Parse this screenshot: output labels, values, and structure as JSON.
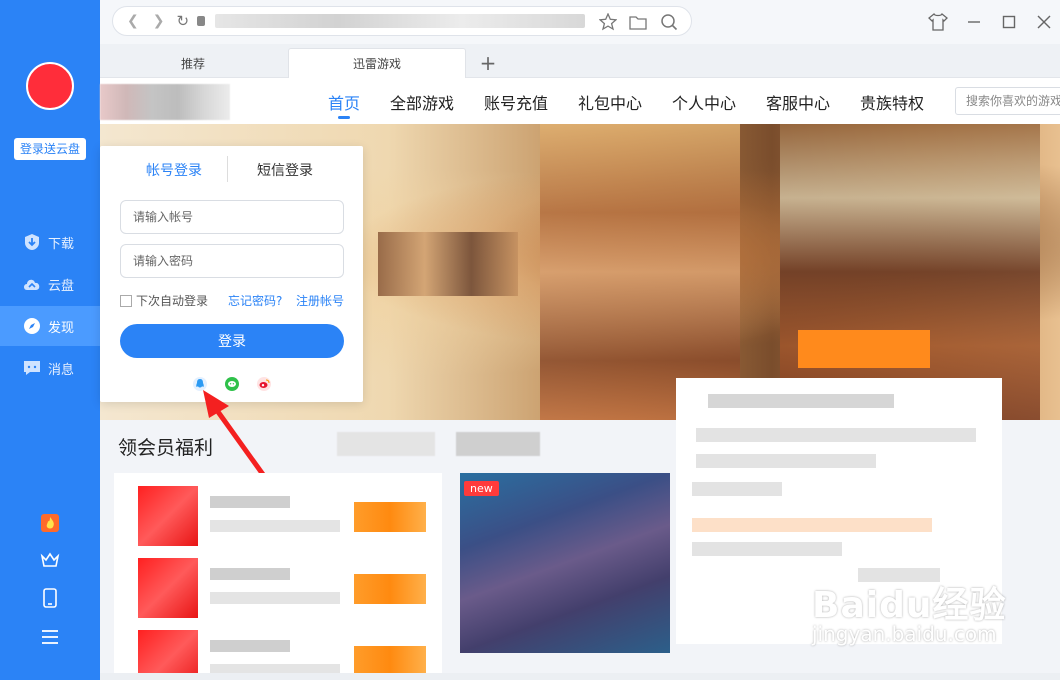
{
  "sidebar": {
    "login_badge": "登录送云盘",
    "items": [
      {
        "label": "下载",
        "icon": "download-icon"
      },
      {
        "label": "云盘",
        "icon": "cloud-icon"
      },
      {
        "label": "发现",
        "icon": "compass-icon",
        "active": true
      },
      {
        "label": "消息",
        "icon": "message-icon"
      }
    ],
    "bottom_icons": [
      "fire-icon",
      "crown-icon",
      "phone-icon",
      "menu-icon"
    ]
  },
  "browser": {
    "tabs": [
      {
        "label": "推荐"
      },
      {
        "label": "迅雷游戏",
        "active": true
      }
    ],
    "new_tab": "+"
  },
  "site_nav": {
    "items": [
      "首页",
      "全部游戏",
      "账号充值",
      "礼包中心",
      "个人中心",
      "客服中心",
      "贵族特权"
    ],
    "active_index": 0,
    "search_placeholder": "搜索你喜欢的游戏"
  },
  "login": {
    "tab_account": "帐号登录",
    "tab_sms": "短信登录",
    "account_placeholder": "请输入帐号",
    "password_placeholder": "请输入密码",
    "remember": "下次自动登录",
    "forgot": "忘记密码?",
    "register": "注册帐号",
    "submit": "登录",
    "social": [
      "qq-icon",
      "wechat-icon",
      "weibo-icon"
    ]
  },
  "benefits": {
    "title": "领会员福利"
  },
  "game_card": {
    "badge": "new"
  },
  "watermark": {
    "logo": "Baidu经验",
    "url": "jingyan.baidu.com"
  },
  "colors": {
    "accent": "#2b83f6",
    "sidebar": "#2b83f6",
    "avatar": "#ff2d3a",
    "orange": "#ff8a1c"
  }
}
